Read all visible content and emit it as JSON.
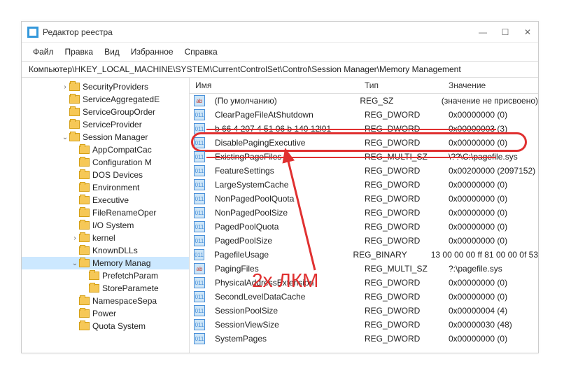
{
  "window": {
    "title": "Редактор реестра",
    "controls": {
      "min": "—",
      "max": "☐",
      "close": "✕"
    }
  },
  "menu": {
    "file": "Файл",
    "edit": "Правка",
    "view": "Вид",
    "fav": "Избранное",
    "help": "Справка"
  },
  "address": "Компьютер\\HKEY_LOCAL_MACHINE\\SYSTEM\\CurrentControlSet\\Control\\Session Manager\\Memory Management",
  "tree": [
    {
      "depth": 4,
      "caret": ">",
      "label": "SecurityProviders"
    },
    {
      "depth": 4,
      "caret": "",
      "label": "ServiceAggregatedE"
    },
    {
      "depth": 4,
      "caret": "",
      "label": "ServiceGroupOrder"
    },
    {
      "depth": 4,
      "caret": "",
      "label": "ServiceProvider"
    },
    {
      "depth": 4,
      "caret": "v",
      "label": "Session Manager"
    },
    {
      "depth": 5,
      "caret": "",
      "label": "AppCompatCac"
    },
    {
      "depth": 5,
      "caret": "",
      "label": "Configuration M"
    },
    {
      "depth": 5,
      "caret": "",
      "label": "DOS Devices"
    },
    {
      "depth": 5,
      "caret": "",
      "label": "Environment"
    },
    {
      "depth": 5,
      "caret": "",
      "label": "Executive"
    },
    {
      "depth": 5,
      "caret": "",
      "label": "FileRenameOper"
    },
    {
      "depth": 5,
      "caret": "",
      "label": "I/O System"
    },
    {
      "depth": 5,
      "caret": ">",
      "label": "kernel"
    },
    {
      "depth": 5,
      "caret": "",
      "label": "KnownDLLs"
    },
    {
      "depth": 5,
      "caret": "v",
      "label": "Memory Manag",
      "sel": true
    },
    {
      "depth": 6,
      "caret": "",
      "label": "PrefetchParam"
    },
    {
      "depth": 6,
      "caret": "",
      "label": "StoreParamete"
    },
    {
      "depth": 5,
      "caret": "",
      "label": "NamespaceSepa"
    },
    {
      "depth": 5,
      "caret": "",
      "label": "Power"
    },
    {
      "depth": 5,
      "caret": "",
      "label": "Quota System"
    }
  ],
  "cols": {
    "name": "Имя",
    "type": "Тип",
    "val": "Значение"
  },
  "rows": [
    {
      "icon": "ab",
      "name": "(По умолчанию)",
      "type": "REG_SZ",
      "val": "(значение не присвоено)"
    },
    {
      "icon": "011",
      "name": "ClearPageFileAtShutdown",
      "type": "REG_DWORD",
      "val": "0x00000000 (0)"
    },
    {
      "icon": "011",
      "name": "b  66  4  207   4  51   06 b  140  12l01",
      "type": "REG_DWORD",
      "val": "0x00000003 (3)",
      "strike": true
    },
    {
      "icon": "011",
      "name": "DisablePagingExecutive",
      "type": "REG_DWORD",
      "val": "0x00000000 (0)",
      "boxed": true
    },
    {
      "icon": "011",
      "name": "ExistingPageFiles",
      "type": "REG_MULTI_SZ",
      "val": "\\??\\C:\\pagefile.sys",
      "strike": true
    },
    {
      "icon": "011",
      "name": "FeatureSettings",
      "type": "REG_DWORD",
      "val": "0x00200000 (2097152)"
    },
    {
      "icon": "011",
      "name": "LargeSystemCache",
      "type": "REG_DWORD",
      "val": "0x00000000 (0)"
    },
    {
      "icon": "011",
      "name": "NonPagedPoolQuota",
      "type": "REG_DWORD",
      "val": "0x00000000 (0)"
    },
    {
      "icon": "011",
      "name": "NonPagedPoolSize",
      "type": "REG_DWORD",
      "val": "0x00000000 (0)"
    },
    {
      "icon": "011",
      "name": "PagedPoolQuota",
      "type": "REG_DWORD",
      "val": "0x00000000 (0)"
    },
    {
      "icon": "011",
      "name": "PagedPoolSize",
      "type": "REG_DWORD",
      "val": "0x00000000 (0)"
    },
    {
      "icon": "011",
      "name": "PagefileUsage",
      "type": "REG_BINARY",
      "val": "13 00 00 00 ff 81 00 00 0f 53"
    },
    {
      "icon": "ab",
      "name": "PagingFiles",
      "type": "REG_MULTI_SZ",
      "val": "?:\\pagefile.sys"
    },
    {
      "icon": "011",
      "name": "PhysicalAddressExtension",
      "type": "REG_DWORD",
      "val": "0x00000000 (0)"
    },
    {
      "icon": "011",
      "name": "SecondLevelDataCache",
      "type": "REG_DWORD",
      "val": "0x00000000 (0)"
    },
    {
      "icon": "011",
      "name": "SessionPoolSize",
      "type": "REG_DWORD",
      "val": "0x00000004 (4)"
    },
    {
      "icon": "011",
      "name": "SessionViewSize",
      "type": "REG_DWORD",
      "val": "0x00000030 (48)"
    },
    {
      "icon": "011",
      "name": "SystemPages",
      "type": "REG_DWORD",
      "val": "0x00000000 (0)"
    }
  ],
  "annotation": "2x ЛКМ"
}
